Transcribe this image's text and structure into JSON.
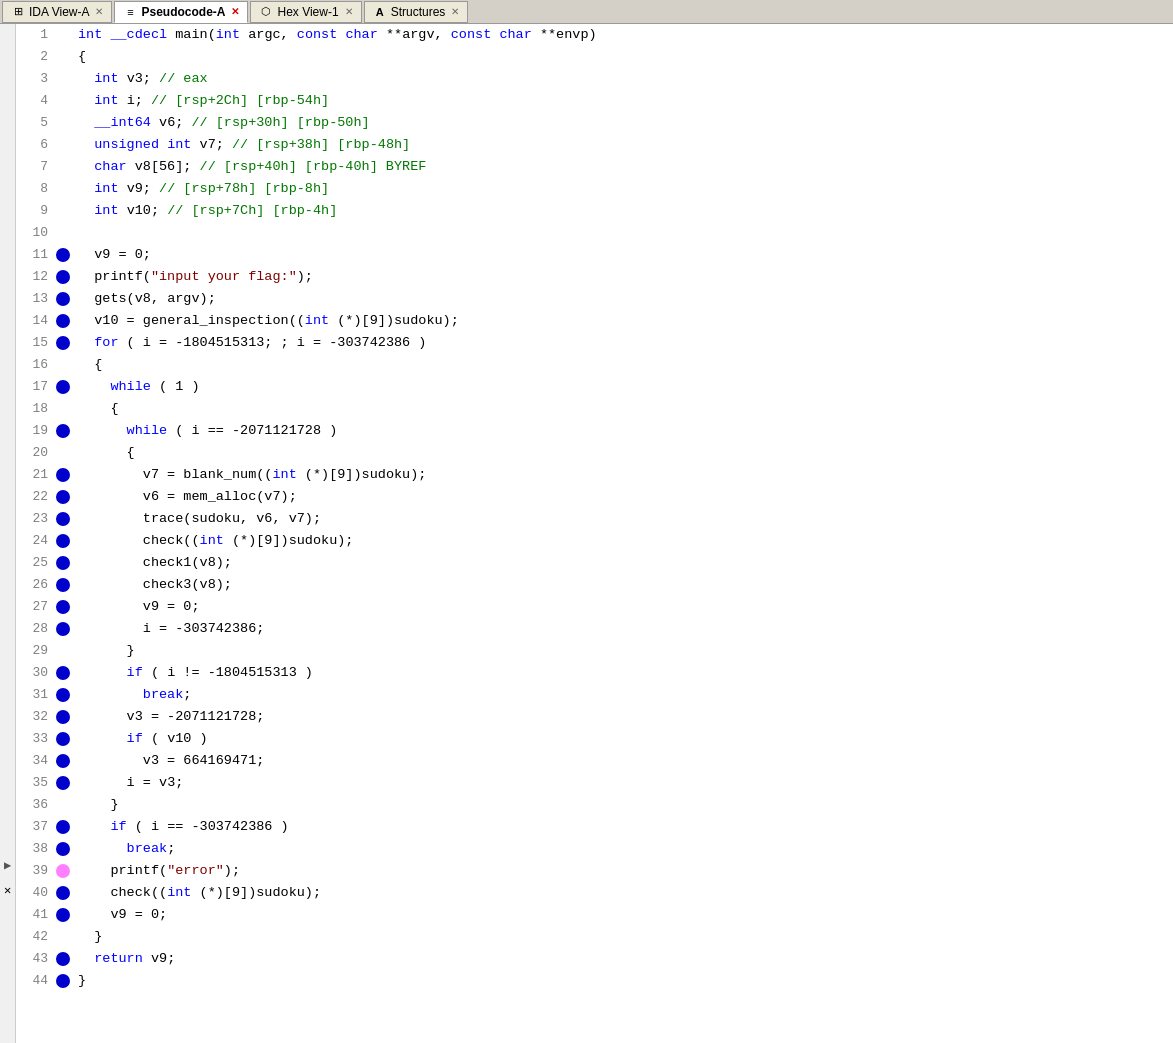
{
  "tabs": [
    {
      "id": "ida-view",
      "icon": "⊞",
      "label": "IDA View-A",
      "active": false,
      "closable": true
    },
    {
      "id": "pseudocode",
      "icon": "≡",
      "label": "Pseudocode-A",
      "active": true,
      "closable": true
    },
    {
      "id": "hex-view",
      "icon": "⬡",
      "label": "Hex View-1",
      "active": false,
      "closable": true
    },
    {
      "id": "structures",
      "icon": "A",
      "label": "Structures",
      "active": false,
      "closable": true
    }
  ],
  "lines": [
    {
      "num": 1,
      "bp": false,
      "bp_pink": false,
      "text": "int __cdecl main(int argc, const char **argv, const char **envp)"
    },
    {
      "num": 2,
      "bp": false,
      "bp_pink": false,
      "text": "{"
    },
    {
      "num": 3,
      "bp": false,
      "bp_pink": false,
      "text": "  int v3; // eax"
    },
    {
      "num": 4,
      "bp": false,
      "bp_pink": false,
      "text": "  int i; // [rsp+2Ch] [rbp-54h]"
    },
    {
      "num": 5,
      "bp": false,
      "bp_pink": false,
      "text": "  __int64 v6; // [rsp+30h] [rbp-50h]"
    },
    {
      "num": 6,
      "bp": false,
      "bp_pink": false,
      "text": "  unsigned int v7; // [rsp+38h] [rbp-48h]"
    },
    {
      "num": 7,
      "bp": false,
      "bp_pink": false,
      "text": "  char v8[56]; // [rsp+40h] [rbp-40h] BYREF"
    },
    {
      "num": 8,
      "bp": false,
      "bp_pink": false,
      "text": "  int v9; // [rsp+78h] [rbp-8h]"
    },
    {
      "num": 9,
      "bp": false,
      "bp_pink": false,
      "text": "  int v10; // [rsp+7Ch] [rbp-4h]"
    },
    {
      "num": 10,
      "bp": false,
      "bp_pink": false,
      "text": ""
    },
    {
      "num": 11,
      "bp": true,
      "bp_pink": false,
      "text": "  v9 = 0;"
    },
    {
      "num": 12,
      "bp": true,
      "bp_pink": false,
      "text": "  printf(\"input your flag:\");"
    },
    {
      "num": 13,
      "bp": true,
      "bp_pink": false,
      "text": "  gets(v8, argv);"
    },
    {
      "num": 14,
      "bp": true,
      "bp_pink": false,
      "text": "  v10 = general_inspection((int (*)[9])sudoku);"
    },
    {
      "num": 15,
      "bp": true,
      "bp_pink": false,
      "text": "  for ( i = -1804515313; ; i = -303742386 )"
    },
    {
      "num": 16,
      "bp": false,
      "bp_pink": false,
      "text": "  {"
    },
    {
      "num": 17,
      "bp": true,
      "bp_pink": false,
      "text": "    while ( 1 )"
    },
    {
      "num": 18,
      "bp": false,
      "bp_pink": false,
      "text": "    {"
    },
    {
      "num": 19,
      "bp": true,
      "bp_pink": false,
      "text": "      while ( i == -2071121728 )"
    },
    {
      "num": 20,
      "bp": false,
      "bp_pink": false,
      "text": "      {"
    },
    {
      "num": 21,
      "bp": true,
      "bp_pink": false,
      "text": "        v7 = blank_num((int (*)[9])sudoku);"
    },
    {
      "num": 22,
      "bp": true,
      "bp_pink": false,
      "text": "        v6 = mem_alloc(v7);"
    },
    {
      "num": 23,
      "bp": true,
      "bp_pink": false,
      "text": "        trace(sudoku, v6, v7);"
    },
    {
      "num": 24,
      "bp": true,
      "bp_pink": false,
      "text": "        check((int (*)[9])sudoku);"
    },
    {
      "num": 25,
      "bp": true,
      "bp_pink": false,
      "text": "        check1(v8);"
    },
    {
      "num": 26,
      "bp": true,
      "bp_pink": false,
      "text": "        check3(v8);"
    },
    {
      "num": 27,
      "bp": true,
      "bp_pink": false,
      "text": "        v9 = 0;"
    },
    {
      "num": 28,
      "bp": true,
      "bp_pink": false,
      "text": "        i = -303742386;"
    },
    {
      "num": 29,
      "bp": false,
      "bp_pink": false,
      "text": "      }"
    },
    {
      "num": 30,
      "bp": true,
      "bp_pink": false,
      "text": "      if ( i != -1804515313 )"
    },
    {
      "num": 31,
      "bp": true,
      "bp_pink": false,
      "text": "        break;"
    },
    {
      "num": 32,
      "bp": true,
      "bp_pink": false,
      "text": "      v3 = -2071121728;"
    },
    {
      "num": 33,
      "bp": true,
      "bp_pink": false,
      "text": "      if ( v10 )"
    },
    {
      "num": 34,
      "bp": true,
      "bp_pink": false,
      "text": "        v3 = 664169471;"
    },
    {
      "num": 35,
      "bp": true,
      "bp_pink": false,
      "text": "      i = v3;"
    },
    {
      "num": 36,
      "bp": false,
      "bp_pink": false,
      "text": "    }"
    },
    {
      "num": 37,
      "bp": true,
      "bp_pink": false,
      "text": "    if ( i == -303742386 )"
    },
    {
      "num": 38,
      "bp": true,
      "bp_pink": false,
      "text": "      break;"
    },
    {
      "num": 39,
      "bp": true,
      "bp_pink": true,
      "text": "    printf(\"error\");"
    },
    {
      "num": 40,
      "bp": true,
      "bp_pink": false,
      "text": "    check((int (*)[9])sudoku);"
    },
    {
      "num": 41,
      "bp": true,
      "bp_pink": false,
      "text": "    v9 = 0;"
    },
    {
      "num": 42,
      "bp": false,
      "bp_pink": false,
      "text": "  }"
    },
    {
      "num": 43,
      "bp": true,
      "bp_pink": false,
      "text": "  return v9;"
    },
    {
      "num": 44,
      "bp": true,
      "bp_pink": false,
      "text": "}"
    }
  ],
  "colors": {
    "keyword": "#0000ff",
    "comment": "#007700",
    "string": "#800000",
    "number": "#800080",
    "variable": "#000080",
    "normal": "#000000",
    "breakpoint": "#0000cc"
  }
}
